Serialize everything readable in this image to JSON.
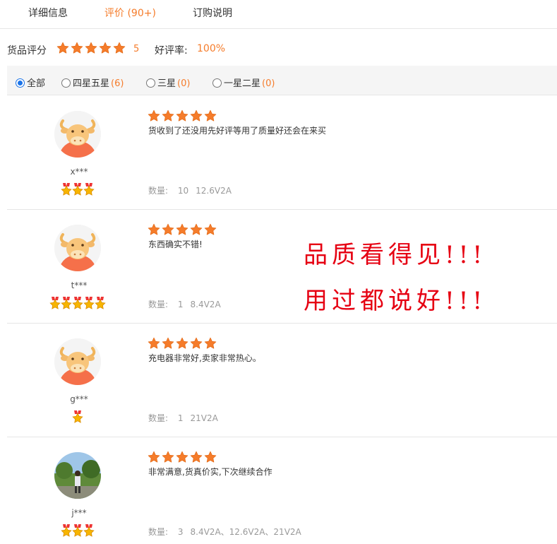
{
  "tabs": [
    {
      "label": "详细信息"
    },
    {
      "label": "评价 (90+)"
    },
    {
      "label": "订购说明"
    }
  ],
  "summary": {
    "score_label": "货品评分",
    "stars": 5,
    "score": "5",
    "rate_label": "好评率:",
    "rate_value": "100%"
  },
  "filter": {
    "options": [
      {
        "label": "全部",
        "count": "",
        "selected": true
      },
      {
        "label": "四星五星",
        "count": "(6)",
        "selected": false
      },
      {
        "label": "三星",
        "count": "(0)",
        "selected": false
      },
      {
        "label": "一星二星",
        "count": "(0)",
        "selected": false
      }
    ]
  },
  "reviews": [
    {
      "user": "x***",
      "medals": 3,
      "stars": 5,
      "text": "货收到了还没用先好评等用了质量好还会在来买",
      "qty_label": "数量:",
      "qty": "10",
      "spec": "12.6V2A",
      "avatar": "cow-avatar"
    },
    {
      "user": "t***",
      "medals": 5,
      "stars": 5,
      "text": "东西确实不错!",
      "qty_label": "数量:",
      "qty": "1",
      "spec": "8.4V2A",
      "avatar": "cow-avatar"
    },
    {
      "user": "g***",
      "medals": 1,
      "stars": 5,
      "text": "充电器非常好,卖家非常热心。",
      "qty_label": "数量:",
      "qty": "1",
      "spec": "21V2A",
      "avatar": "cow-avatar"
    },
    {
      "user": "j***",
      "medals": 3,
      "stars": 5,
      "text": "非常满意,货真价实,下次继续合作",
      "qty_label": "数量:",
      "qty": "3",
      "spec": "8.4V2A、12.6V2A、21V2A",
      "avatar": "photo-avatar"
    }
  ],
  "promo": {
    "line1": "品质看得见!!!",
    "line2": "用过都说好!!!"
  },
  "colors": {
    "accent": "#f57c2b",
    "star": "#f57c2b",
    "promo": "#e60012",
    "radio": "#1a73e8"
  }
}
